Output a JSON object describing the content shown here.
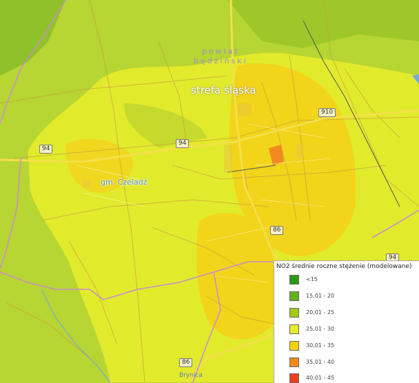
{
  "labels": {
    "powiat_line1": "powiat",
    "powiat_line2": "będziński",
    "strefa": "strefa śląska",
    "gmina": "gm. Czeladź",
    "river": "Brynica"
  },
  "road_shields": [
    "94",
    "94",
    "910",
    "86",
    "86",
    "94"
  ],
  "legend": {
    "title": "NO2 średnie roczne stężenie (modelowane)",
    "items": [
      {
        "label": "<15",
        "color": "#2a9a13"
      },
      {
        "label": "15,01 - 20",
        "color": "#62b21e"
      },
      {
        "label": "20,01 - 25",
        "color": "#a4c919"
      },
      {
        "label": "25,01 - 30",
        "color": "#e6ec2a"
      },
      {
        "label": "30,01 - 35",
        "color": "#f6d20c"
      },
      {
        "label": "35,01 - 40",
        "color": "#f28a18"
      },
      {
        "label": "40,01 - 45",
        "color": "#e8401b"
      }
    ]
  }
}
